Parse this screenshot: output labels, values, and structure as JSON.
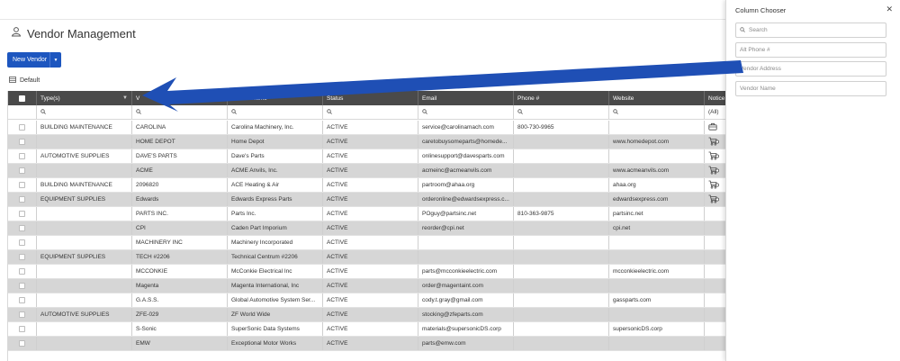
{
  "page": {
    "title": "Vendor Management"
  },
  "toolbar": {
    "new_vendor_label": "New Vendor",
    "view_label": "Default"
  },
  "grid": {
    "columns": [
      "Type(s)",
      "V",
      "Vendor Name",
      "Status",
      "Email",
      "Phone #",
      "Website",
      "Notice"
    ],
    "notices_filter_value": "(All)",
    "rows": [
      {
        "type": "BUILDING MAINTENANCE",
        "vendor": "CAROLINA",
        "name": "Carolina Machinery, Inc.",
        "status": "ACTIVE",
        "email": "service@carolinamach.com",
        "phone": "800-730-9965",
        "website": "",
        "notice": "toolbox-icon"
      },
      {
        "type": "",
        "vendor": "HOME DEPOT",
        "name": "Home Depot",
        "status": "ACTIVE",
        "email": "caretobuysomeparts@homede...",
        "phone": "",
        "website": "www.homedepot.com",
        "notice": "cart-icon"
      },
      {
        "type": "AUTOMOTIVE SUPPLIES",
        "vendor": "DAVE'S PARTS",
        "name": "Dave's Parts",
        "status": "ACTIVE",
        "email": "onlinesupport@davesparts.com",
        "phone": "",
        "website": "",
        "notice": "cart-icon"
      },
      {
        "type": "",
        "vendor": "ACME",
        "name": "ACME Anvils, Inc.",
        "status": "ACTIVE",
        "email": "acmeinc@acmeanvils.com",
        "phone": "",
        "website": "www.acmeanvils.com",
        "notice": "cart-icon"
      },
      {
        "type": "BUILDING MAINTENANCE",
        "vendor": "2096820",
        "name": "ACE Heating & Air",
        "status": "ACTIVE",
        "email": "partroom@ahaa.org",
        "phone": "",
        "website": "ahaa.org",
        "notice": "cart-icon"
      },
      {
        "type": "EQUIPMENT SUPPLIES",
        "vendor": "Edwards",
        "name": "Edwards Express Parts",
        "status": "ACTIVE",
        "email": "orderonline@edwardsexpress.c...",
        "phone": "",
        "website": "edwardsexpress.com",
        "notice": "cart-icon"
      },
      {
        "type": "",
        "vendor": "PARTS INC.",
        "name": "Parts Inc.",
        "status": "ACTIVE",
        "email": "POguy@partsinc.net",
        "phone": "810-363-9875",
        "website": "partsinc.net",
        "notice": ""
      },
      {
        "type": "",
        "vendor": "CPI",
        "name": "Caden Part Imporium",
        "status": "ACTIVE",
        "email": "reorder@cpi.net",
        "phone": "",
        "website": "cpi.net",
        "notice": ""
      },
      {
        "type": "",
        "vendor": "MACHINERY INC",
        "name": "Machinery Incorporated",
        "status": "ACTIVE",
        "email": "",
        "phone": "",
        "website": "",
        "notice": ""
      },
      {
        "type": "EQUIPMENT SUPPLIES",
        "vendor": "TECH #2206",
        "name": "Technical Centrum #2206",
        "status": "ACTIVE",
        "email": "",
        "phone": "",
        "website": "",
        "notice": ""
      },
      {
        "type": "",
        "vendor": "MCCONKIE",
        "name": "McConkie Electrical Inc",
        "status": "ACTIVE",
        "email": "parts@mcconkieelectric.com",
        "phone": "",
        "website": "mcconkieelectric.com",
        "notice": ""
      },
      {
        "type": "",
        "vendor": "Magenta",
        "name": "Magenta International, Inc",
        "status": "ACTIVE",
        "email": "order@magentaint.com",
        "phone": "",
        "website": "",
        "notice": ""
      },
      {
        "type": "",
        "vendor": "G.A.S.S.",
        "name": "Global Automotive System Ser...",
        "status": "ACTIVE",
        "email": "cody.t.gray@gmail.com",
        "phone": "",
        "website": "gassparts.com",
        "notice": ""
      },
      {
        "type": "AUTOMOTIVE SUPPLIES",
        "vendor": "ZFE-029",
        "name": "ZF World Wide",
        "status": "ACTIVE",
        "email": "stocking@zfeparts.com",
        "phone": "",
        "website": "",
        "notice": ""
      },
      {
        "type": "",
        "vendor": "S-Sonic",
        "name": "SuperSonic Data Systems",
        "status": "ACTIVE",
        "email": "materials@supersonicDS.corp",
        "phone": "",
        "website": "supersonicDS.corp",
        "notice": ""
      },
      {
        "type": "",
        "vendor": "EMW",
        "name": "Exceptional Motor Works",
        "status": "ACTIVE",
        "email": "parts@emw.com",
        "phone": "",
        "website": "",
        "notice": ""
      }
    ]
  },
  "column_chooser": {
    "title": "Column Chooser",
    "search_placeholder": "Search",
    "items": [
      "Alt Phone #",
      "Vendor Address",
      "Vendor Name"
    ]
  },
  "colors": {
    "accent": "#1d56bf",
    "header_bg": "#4a4a4a",
    "arrow": "#1f4fb5"
  }
}
